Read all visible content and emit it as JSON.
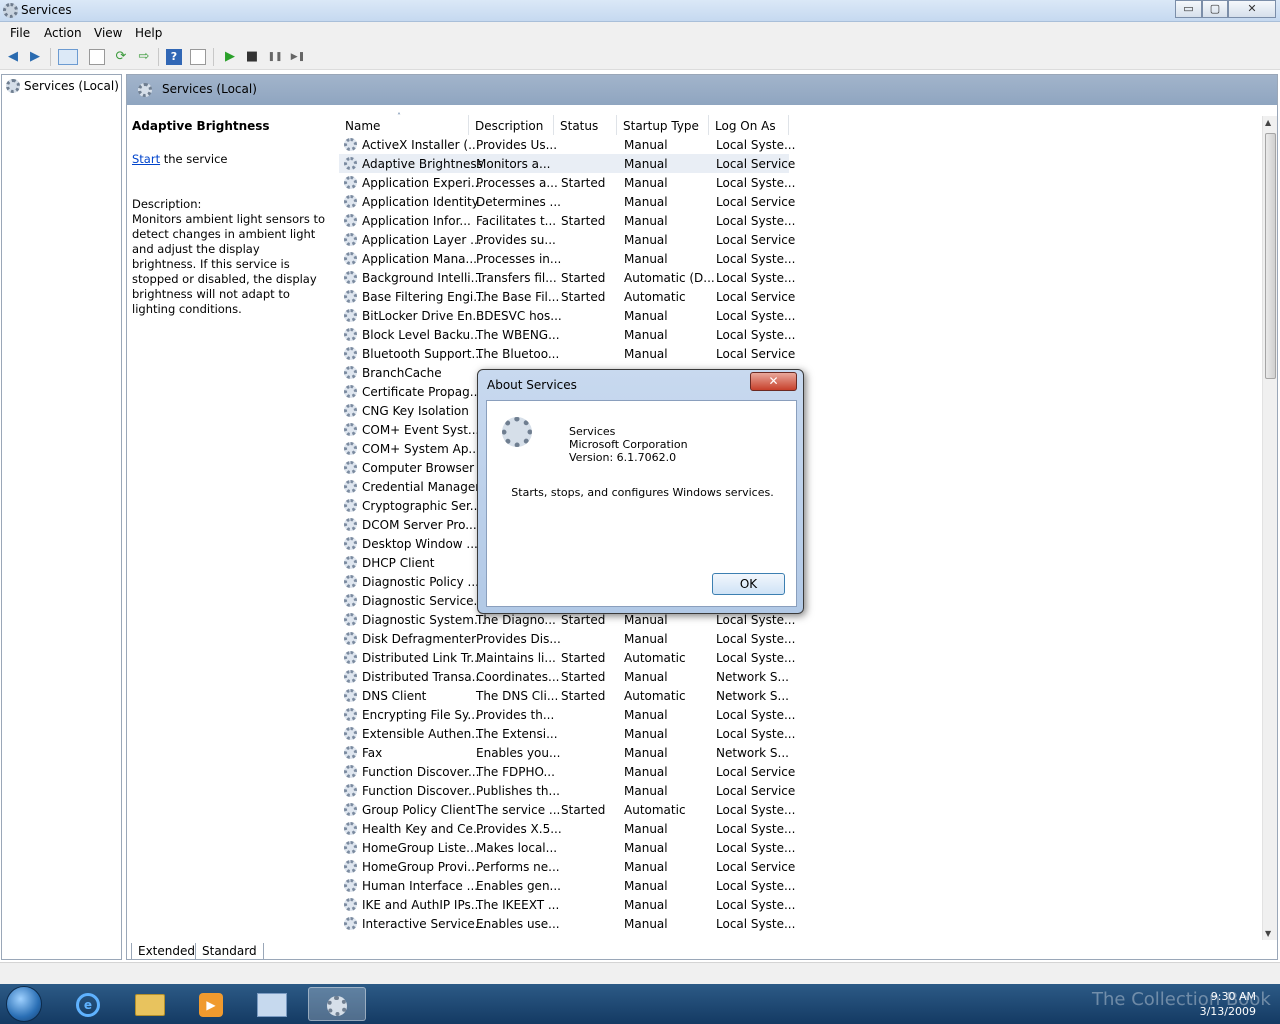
{
  "window": {
    "title": "Services",
    "minimize": "▭",
    "maximize": "▢",
    "close": "✕"
  },
  "menu": [
    "File",
    "Action",
    "View",
    "Help"
  ],
  "toolbar": {
    "back": "◀",
    "forward": "▶",
    "play": "▶",
    "stop": "■",
    "pause": "❚❚",
    "restart": "▶❚"
  },
  "tree": {
    "item": "Services (Local)"
  },
  "content": {
    "header": "Services (Local)"
  },
  "desc": {
    "title": "Adaptive Brightness",
    "start_link": "Start",
    "start_rest": " the service",
    "label": "Description:",
    "text": "Monitors ambient light sensors to detect changes in ambient light and adjust the display brightness.  If this service is stopped or disabled, the display brightness will not adapt to lighting conditions."
  },
  "table": {
    "columns": [
      "Name",
      "Description",
      "Status",
      "Startup Type",
      "Log On As"
    ],
    "rows": [
      [
        "ActiveX Installer (...",
        "Provides Us...",
        "",
        "Manual",
        "Local Syste..."
      ],
      [
        "Adaptive Brightness",
        "Monitors a...",
        "",
        "Manual",
        "Local Service"
      ],
      [
        "Application Experi...",
        "Processes a...",
        "Started",
        "Manual",
        "Local Syste..."
      ],
      [
        "Application Identity",
        "Determines ...",
        "",
        "Manual",
        "Local Service"
      ],
      [
        "Application Infor...",
        "Facilitates t...",
        "Started",
        "Manual",
        "Local Syste..."
      ],
      [
        "Application Layer ...",
        "Provides su...",
        "",
        "Manual",
        "Local Service"
      ],
      [
        "Application Mana...",
        "Processes in...",
        "",
        "Manual",
        "Local Syste..."
      ],
      [
        "Background Intelli...",
        "Transfers fil...",
        "Started",
        "Automatic (D...",
        "Local Syste..."
      ],
      [
        "Base Filtering Engi...",
        "The Base Fil...",
        "Started",
        "Automatic",
        "Local Service"
      ],
      [
        "BitLocker Drive En...",
        "BDESVC hos...",
        "",
        "Manual",
        "Local Syste..."
      ],
      [
        "Block Level Backu...",
        "The WBENG...",
        "",
        "Manual",
        "Local Syste..."
      ],
      [
        "Bluetooth Support...",
        "The Bluetoo...",
        "",
        "Manual",
        "Local Service"
      ],
      [
        "BranchCache",
        "",
        "",
        "",
        ""
      ],
      [
        "Certificate Propag...",
        "",
        "",
        "",
        ""
      ],
      [
        "CNG Key Isolation",
        "",
        "",
        "",
        ""
      ],
      [
        "COM+ Event Syst...",
        "",
        "",
        "",
        ""
      ],
      [
        "COM+ System Ap...",
        "",
        "",
        "",
        ""
      ],
      [
        "Computer Browser",
        "",
        "",
        "",
        ""
      ],
      [
        "Credential Manager",
        "",
        "",
        "",
        ""
      ],
      [
        "Cryptographic Ser...",
        "",
        "",
        "",
        ""
      ],
      [
        "DCOM Server Pro...",
        "",
        "",
        "",
        ""
      ],
      [
        "Desktop Window ...",
        "",
        "",
        "",
        ""
      ],
      [
        "DHCP Client",
        "",
        "",
        "",
        ""
      ],
      [
        "Diagnostic Policy ...",
        "",
        "",
        "",
        ""
      ],
      [
        "Diagnostic Service...",
        "",
        "",
        "",
        ""
      ],
      [
        "Diagnostic System...",
        "The Diagno...",
        "Started",
        "Manual",
        "Local Syste..."
      ],
      [
        "Disk Defragmenter",
        "Provides Dis...",
        "",
        "Manual",
        "Local Syste..."
      ],
      [
        "Distributed Link Tr...",
        "Maintains li...",
        "Started",
        "Automatic",
        "Local Syste..."
      ],
      [
        "Distributed Transa...",
        "Coordinates...",
        "Started",
        "Manual",
        "Network S..."
      ],
      [
        "DNS Client",
        "The DNS Cli...",
        "Started",
        "Automatic",
        "Network S..."
      ],
      [
        "Encrypting File Sy...",
        "Provides th...",
        "",
        "Manual",
        "Local Syste..."
      ],
      [
        "Extensible Authen...",
        "The Extensi...",
        "",
        "Manual",
        "Local Syste..."
      ],
      [
        "Fax",
        "Enables you...",
        "",
        "Manual",
        "Network S..."
      ],
      [
        "Function Discover...",
        "The FDPHO...",
        "",
        "Manual",
        "Local Service"
      ],
      [
        "Function Discover...",
        "Publishes th...",
        "",
        "Manual",
        "Local Service"
      ],
      [
        "Group Policy Client",
        "The service ...",
        "Started",
        "Automatic",
        "Local Syste..."
      ],
      [
        "Health Key and Ce...",
        "Provides X.5...",
        "",
        "Manual",
        "Local Syste..."
      ],
      [
        "HomeGroup Liste...",
        "Makes local...",
        "",
        "Manual",
        "Local Syste..."
      ],
      [
        "HomeGroup Provi...",
        "Performs ne...",
        "",
        "Manual",
        "Local Service"
      ],
      [
        "Human Interface ...",
        "Enables gen...",
        "",
        "Manual",
        "Local Syste..."
      ],
      [
        "IKE and AuthIP IPs...",
        "The IKEEXT ...",
        "",
        "Manual",
        "Local Syste..."
      ],
      [
        "Interactive Service...",
        "Enables use...",
        "",
        "Manual",
        "Local Syste..."
      ]
    ],
    "selected_index": 1
  },
  "tabs": [
    "Extended",
    "Standard"
  ],
  "dialog": {
    "title": "About Services",
    "close": "✕",
    "app_name": "Services",
    "company": "Microsoft Corporation",
    "version": "Version: 6.1.7062.0",
    "blurb": "Starts, stops, and configures Windows services.",
    "ok": "OK"
  },
  "taskbar": {
    "time": "9:30 AM",
    "date": "3/13/2009",
    "watermark": "The Collection Book"
  }
}
